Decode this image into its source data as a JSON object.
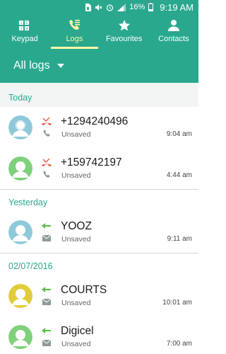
{
  "status": {
    "battery": "16%",
    "time": "9:19 AM"
  },
  "tabs": [
    {
      "label": "Keypad",
      "icon": "keypad-icon",
      "active": false
    },
    {
      "label": "Logs",
      "icon": "call-logs-icon",
      "active": true
    },
    {
      "label": "Favourites",
      "icon": "star-icon",
      "active": false
    },
    {
      "label": "Contacts",
      "icon": "person-icon",
      "active": false
    }
  ],
  "filter": {
    "label": "All logs"
  },
  "sections": [
    {
      "header": "Today",
      "rows": [
        {
          "name": "+1294240496",
          "sub": "Unsaved",
          "time": "9:04 am",
          "avatar_color": "#8ec9d9",
          "type": "missed-call"
        },
        {
          "name": "+159742197",
          "sub": "Unsaved",
          "time": "4:44 am",
          "avatar_color": "#7fd07a",
          "type": "missed-call"
        }
      ]
    },
    {
      "header": "Yesterday",
      "rows": [
        {
          "name": "YOOZ",
          "sub": "Unsaved",
          "time": "9:11 am",
          "avatar_color": "#8ec9d9",
          "type": "incoming-message"
        }
      ]
    },
    {
      "header": "02/07/2016",
      "rows": [
        {
          "name": "COURTS",
          "sub": "Unsaved",
          "time": "10:01 am",
          "avatar_color": "#e2cc3c",
          "type": "incoming-message"
        },
        {
          "name": "Digicel",
          "sub": "Unsaved",
          "time": "7:00 am",
          "avatar_color": "#7fd07a",
          "type": "incoming-message"
        }
      ]
    }
  ],
  "colors": {
    "accent": "#2aa88e",
    "active_tab": "#fff6a6",
    "missed": "#e05a4f",
    "incoming_arrow": "#57c043"
  }
}
